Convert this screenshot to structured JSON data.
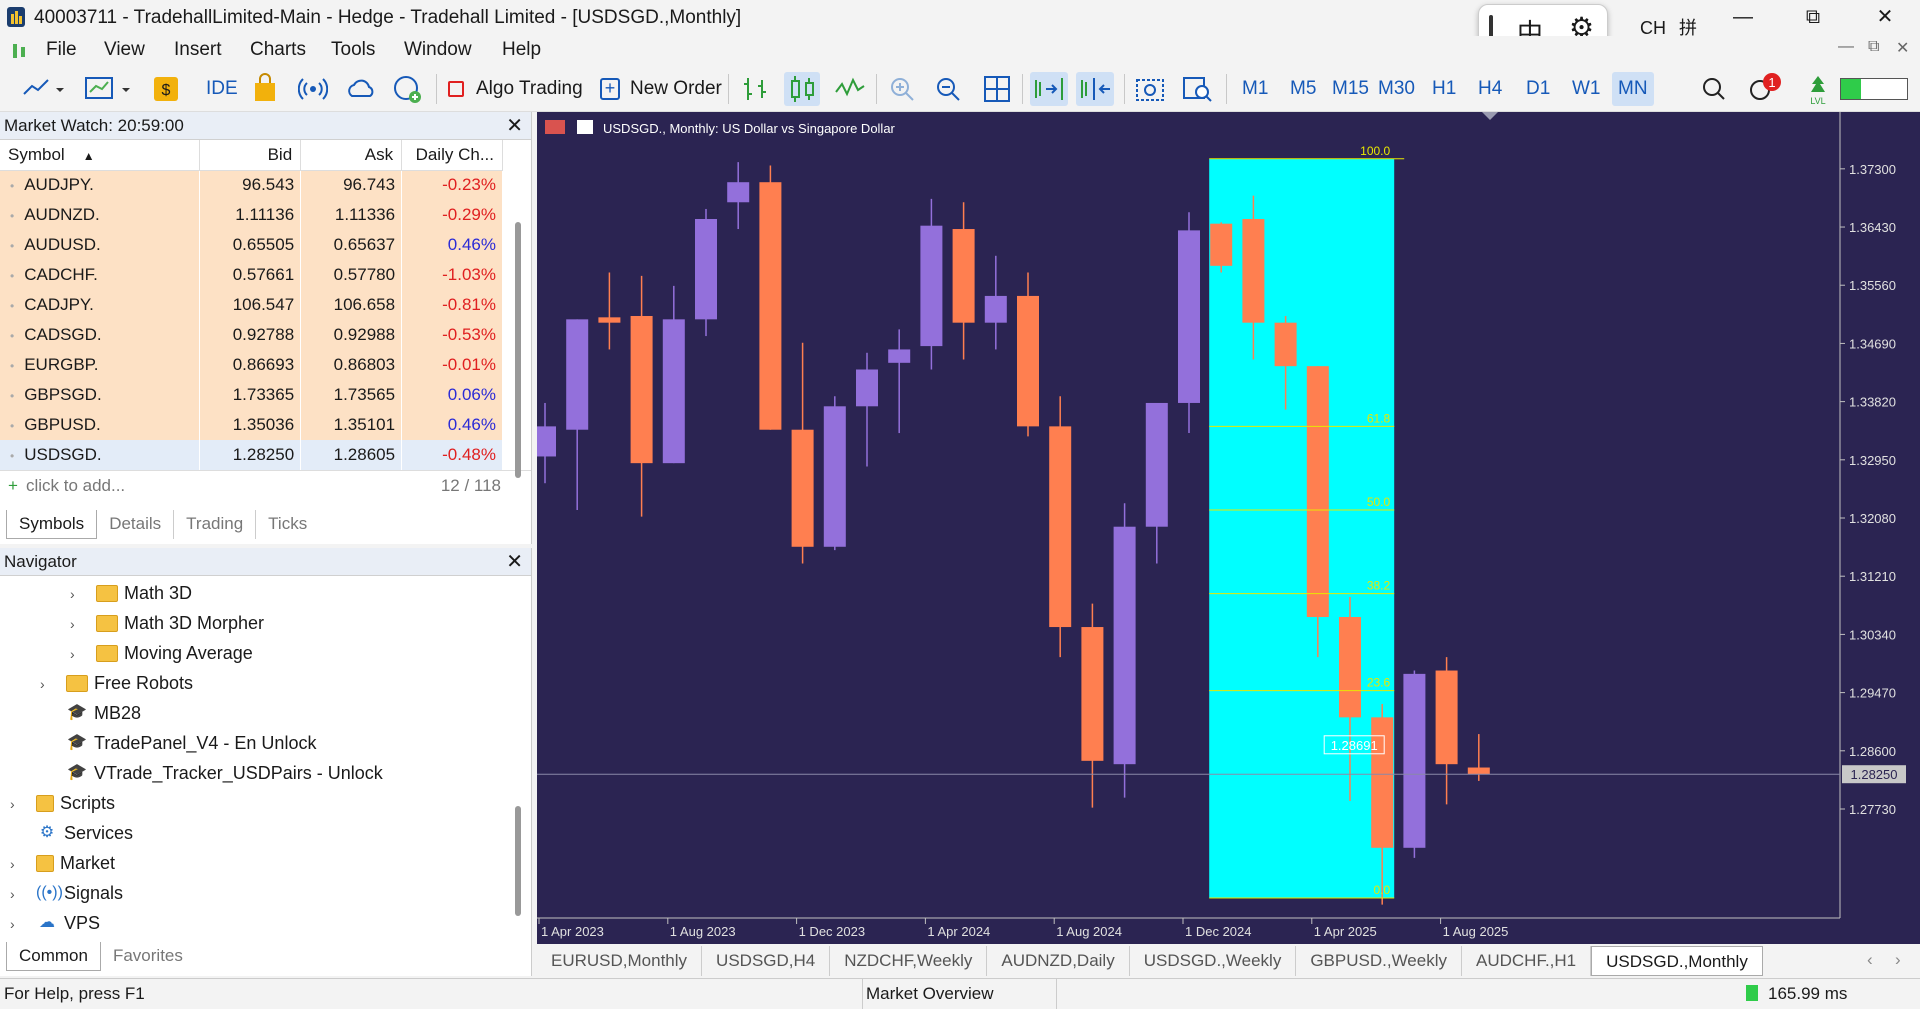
{
  "window": {
    "title": "40003711 - TradehallLimited-Main - Hedge - Tradehall Limited - [USDSGD.,Monthly]",
    "min": "—",
    "max": "⧉",
    "close": "✕"
  },
  "ime": {
    "lang": "中",
    "settings": "⚙",
    "ch": "CH",
    "grid": "拼"
  },
  "menu": [
    "File",
    "View",
    "Insert",
    "Charts",
    "Tools",
    "Window",
    "Help"
  ],
  "toolbar": {
    "ide": "IDE",
    "algo": "Algo Trading",
    "new_order": "New Order",
    "timeframes": [
      "M1",
      "M5",
      "M15",
      "M30",
      "H1",
      "H4",
      "D1",
      "W1",
      "MN"
    ],
    "active_tf": "MN",
    "notif_count": "1",
    "lvl": "LVL"
  },
  "market_watch": {
    "title": "Market Watch: 20:59:00",
    "columns": [
      "Symbol",
      "Bid",
      "Ask",
      "Daily Ch..."
    ],
    "rows": [
      [
        "AUDJPY.",
        "96.543",
        "96.743",
        "-0.23%"
      ],
      [
        "AUDNZD.",
        "1.11136",
        "1.11336",
        "-0.29%"
      ],
      [
        "AUDUSD.",
        "0.65505",
        "0.65637",
        "0.46%"
      ],
      [
        "CADCHF.",
        "0.57661",
        "0.57780",
        "-1.03%"
      ],
      [
        "CADJPY.",
        "106.547",
        "106.658",
        "-0.81%"
      ],
      [
        "CADSGD.",
        "0.92788",
        "0.92988",
        "-0.53%"
      ],
      [
        "EURGBP.",
        "0.86693",
        "0.86803",
        "-0.01%"
      ],
      [
        "GBPSGD.",
        "1.73365",
        "1.73565",
        "0.06%"
      ],
      [
        "GBPUSD.",
        "1.35036",
        "1.35101",
        "0.46%"
      ],
      [
        "USDSGD.",
        "1.28250",
        "1.28605",
        "-0.48%"
      ]
    ],
    "add": "click to add...",
    "count": "12 / 118",
    "tabs": [
      "Symbols",
      "Details",
      "Trading",
      "Ticks"
    ]
  },
  "navigator": {
    "title": "Navigator",
    "items": [
      "Math 3D",
      "Math 3D Morpher",
      "Moving Average",
      "Free Robots",
      "MB28",
      "TradePanel_V4 - En Unlock",
      "VTrade_Tracker_USDPairs - Unlock",
      "Scripts",
      "Services",
      "Market",
      "Signals",
      "VPS"
    ],
    "tabs": [
      "Common",
      "Favorites"
    ]
  },
  "chart_data": {
    "type": "candlestick",
    "title": "USDSGD., Monthly: US Dollar vs Singapore Dollar",
    "ylim": [
      1.2625,
      1.38
    ],
    "yticks": [
      "1.37300",
      "1.36430",
      "1.35560",
      "1.34690",
      "1.33820",
      "1.32950",
      "1.32080",
      "1.31210",
      "1.30340",
      "1.29470",
      "1.28600",
      "1.27730"
    ],
    "current_price": "1.28250",
    "xticks": [
      "1 Apr 2023",
      "1 Aug 2023",
      "1 Dec 2023",
      "1 Apr 2024",
      "1 Aug 2024",
      "1 Dec 2024",
      "1 Apr 2025",
      "1 Aug 2025"
    ],
    "candles": [
      {
        "o": 1.33,
        "h": 1.338,
        "l": 1.326,
        "c": 1.3345
      },
      {
        "o": 1.334,
        "h": 1.349,
        "l": 1.322,
        "c": 1.3505
      },
      {
        "o": 1.3508,
        "h": 1.3575,
        "l": 1.346,
        "c": 1.35
      },
      {
        "o": 1.351,
        "h": 1.357,
        "l": 1.321,
        "c": 1.329
      },
      {
        "o": 1.329,
        "h": 1.3555,
        "l": 1.3315,
        "c": 1.3505
      },
      {
        "o": 1.3505,
        "h": 1.367,
        "l": 1.348,
        "c": 1.3655
      },
      {
        "o": 1.368,
        "h": 1.374,
        "l": 1.364,
        "c": 1.371
      },
      {
        "o": 1.371,
        "h": 1.3735,
        "l": 1.335,
        "c": 1.334
      },
      {
        "o": 1.334,
        "h": 1.347,
        "l": 1.314,
        "c": 1.3165
      },
      {
        "o": 1.3165,
        "h": 1.339,
        "l": 1.316,
        "c": 1.3375
      },
      {
        "o": 1.3375,
        "h": 1.3455,
        "l": 1.3285,
        "c": 1.343
      },
      {
        "o": 1.344,
        "h": 1.349,
        "l": 1.3335,
        "c": 1.346
      },
      {
        "o": 1.3465,
        "h": 1.3685,
        "l": 1.343,
        "c": 1.3645
      },
      {
        "o": 1.364,
        "h": 1.368,
        "l": 1.3445,
        "c": 1.35
      },
      {
        "o": 1.35,
        "h": 1.36,
        "l": 1.346,
        "c": 1.354
      },
      {
        "o": 1.354,
        "h": 1.3575,
        "l": 1.333,
        "c": 1.3345
      },
      {
        "o": 1.3345,
        "h": 1.339,
        "l": 1.3,
        "c": 1.3045
      },
      {
        "o": 1.3045,
        "h": 1.308,
        "l": 1.2775,
        "c": 1.2845
      },
      {
        "o": 1.284,
        "h": 1.323,
        "l": 1.279,
        "c": 1.3195
      },
      {
        "o": 1.3195,
        "h": 1.33,
        "l": 1.314,
        "c": 1.338
      },
      {
        "o": 1.338,
        "h": 1.3665,
        "l": 1.3335,
        "c": 1.3638
      },
      {
        "o": 1.3648,
        "h": 1.365,
        "l": 1.3575,
        "c": 1.3585
      },
      {
        "o": 1.3655,
        "h": 1.369,
        "l": 1.3445,
        "c": 1.35
      },
      {
        "o": 1.35,
        "h": 1.351,
        "l": 1.337,
        "c": 1.3435
      },
      {
        "o": 1.3435,
        "h": 1.34,
        "l": 1.3,
        "c": 1.306
      },
      {
        "o": 1.306,
        "h": 1.309,
        "l": 1.2785,
        "c": 1.291
      },
      {
        "o": 1.291,
        "h": 1.293,
        "l": 1.263,
        "c": 1.2715
      },
      {
        "o": 1.2715,
        "h": 1.298,
        "l": 1.27,
        "c": 1.2975
      },
      {
        "o": 1.298,
        "h": 1.3,
        "l": 1.278,
        "c": 1.284
      },
      {
        "o": 1.2835,
        "h": 1.2885,
        "l": 1.2815,
        "c": 1.2825
      }
    ],
    "fib": {
      "levels": [
        "100.0",
        "61.8",
        "50.0",
        "38.2",
        "23.6",
        "0.0"
      ],
      "values": [
        1.3745,
        1.3345,
        1.322,
        1.3095,
        1.295,
        1.264
      ],
      "label_price": "1.28691"
    },
    "colors": {
      "bg": "#2b2452",
      "bull": "#9370db",
      "bear": "#ff7f50",
      "fib": "#00ffff"
    }
  },
  "chart_tabs": [
    "EURUSD,Monthly",
    "USDSGD,H4",
    "NZDCHF,Weekly",
    "AUDNZD,Daily",
    "USDSGD.,Weekly",
    "GBPUSD.,Weekly",
    "AUDCHF.,H1",
    "USDSGD.,Monthly"
  ],
  "status": {
    "help": "For Help, press F1",
    "market": "Market Overview",
    "ping": "165.99 ms"
  }
}
